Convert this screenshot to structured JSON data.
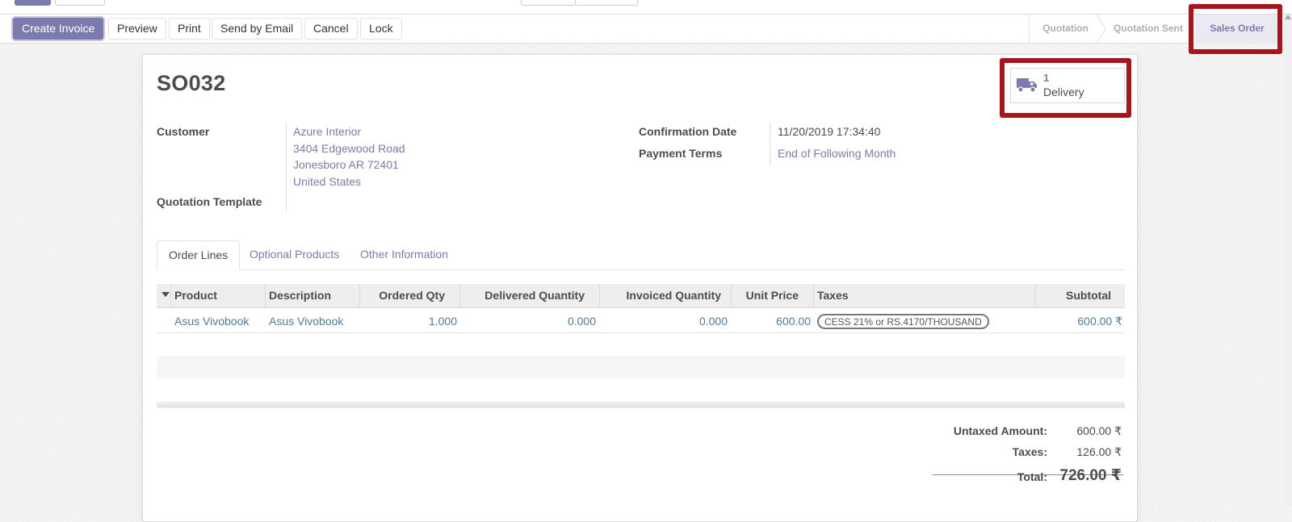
{
  "toolbar": {
    "create_invoice": "Create Invoice",
    "preview": "Preview",
    "print": "Print",
    "send_by_email": "Send by Email",
    "cancel": "Cancel",
    "lock": "Lock"
  },
  "statusbar": {
    "stages": [
      "Quotation",
      "Quotation Sent",
      "Sales Order"
    ],
    "current": "Sales Order"
  },
  "record": {
    "name": "SO032",
    "delivery_count": "1",
    "delivery_label": "Delivery",
    "customer_label": "Customer",
    "customer_lines": [
      "Azure Interior",
      "3404 Edgewood Road",
      "Jonesboro AR 72401",
      "United States"
    ],
    "quotation_template_label": "Quotation Template",
    "confirmation_date_label": "Confirmation Date",
    "confirmation_date": "11/20/2019 17:34:40",
    "payment_terms_label": "Payment Terms",
    "payment_terms": "End of Following Month"
  },
  "tabs": [
    "Order Lines",
    "Optional Products",
    "Other Information"
  ],
  "order_lines": {
    "columns": [
      "Product",
      "Description",
      "Ordered Qty",
      "Delivered Quantity",
      "Invoiced Quantity",
      "Unit Price",
      "Taxes",
      "Subtotal"
    ],
    "rows": [
      {
        "product": "Asus Vivobook",
        "description": "Asus Vivobook",
        "ordered_qty": "1.000",
        "delivered_qty": "0.000",
        "invoiced_qty": "0.000",
        "unit_price": "600.00",
        "taxes": "CESS 21% or RS.4170/THOUSAND",
        "subtotal": "600.00 ₹"
      }
    ]
  },
  "totals": {
    "untaxed_label": "Untaxed Amount:",
    "untaxed": "600.00 ₹",
    "taxes_label": "Taxes:",
    "taxes": "126.00 ₹",
    "total_label": "Total:",
    "total": "726.00 ₹"
  },
  "colors": {
    "accent": "#7c7bad",
    "highlight_box": "#a8141b",
    "link": "#4e7c9e"
  },
  "icons": {
    "delivery": "truck-icon",
    "sort": "caret-down-icon"
  }
}
